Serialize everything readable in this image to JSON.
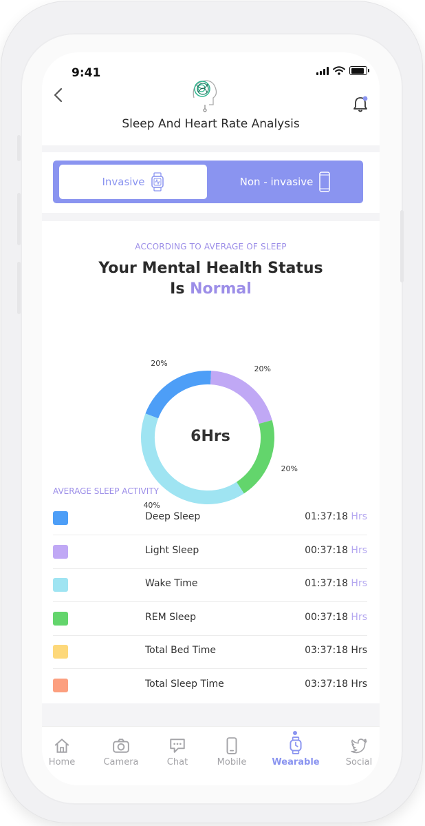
{
  "status_bar": {
    "time": "9:41"
  },
  "header": {
    "title": "Sleep And Heart Rate Analysis"
  },
  "toggle": {
    "invasive_label": "Invasive",
    "non_invasive_label": "Non - invasive",
    "selected": "Invasive"
  },
  "summary": {
    "kicker": "ACCORDING TO AVERAGE OF SLEEP",
    "line1": "Your Mental Health Status",
    "line2_prefix": "Is",
    "status_value": "Normal"
  },
  "chart_data": {
    "type": "pie",
    "center_label": "6Hrs",
    "slices": [
      {
        "label": "Deep Sleep",
        "value": 20,
        "label_text": "20%",
        "color": "#4d9ef7"
      },
      {
        "label": "Light Sleep",
        "value": 20,
        "label_text": "20%",
        "color": "#c0a8f5"
      },
      {
        "label": "REM Sleep",
        "value": 20,
        "label_text": "20%",
        "color": "#63d56c"
      },
      {
        "label": "Wake Time",
        "value": 40,
        "label_text": "40%",
        "color": "#9fe4f2"
      }
    ]
  },
  "activity": {
    "title": "AVERAGE SLEEP ACTIVITY",
    "items": [
      {
        "label": "Deep Sleep",
        "time": "01:37:18",
        "unit": "Hrs",
        "color": "#4d9ef7"
      },
      {
        "label": "Light Sleep",
        "time": "00:37:18",
        "unit": "Hrs",
        "color": "#c0a8f5"
      },
      {
        "label": "Wake Time",
        "time": "01:37:18",
        "unit": "Hrs",
        "color": "#9fe4f2"
      },
      {
        "label": "REM Sleep",
        "time": "00:37:18",
        "unit": "Hrs",
        "color": "#63d56c"
      },
      {
        "label": "Total Bed Time",
        "time": "03:37:18",
        "unit": "Hrs",
        "color": "#fdd87a"
      },
      {
        "label": "Total Sleep Time",
        "time": "03:37:18",
        "unit": "Hrs",
        "color": "#fc9f7f"
      }
    ]
  },
  "tabbar": {
    "active": "Wearable",
    "items": [
      {
        "label": "Home",
        "icon": "home-icon"
      },
      {
        "label": "Camera",
        "icon": "camera-icon"
      },
      {
        "label": "Chat",
        "icon": "chat-icon"
      },
      {
        "label": "Mobile",
        "icon": "mobile-icon"
      },
      {
        "label": "Wearable",
        "icon": "watch-icon"
      },
      {
        "label": "Social",
        "icon": "twitter-icon"
      }
    ]
  },
  "colors": {
    "accent": "#8a94f0",
    "accent_text": "#9c8ee8"
  }
}
